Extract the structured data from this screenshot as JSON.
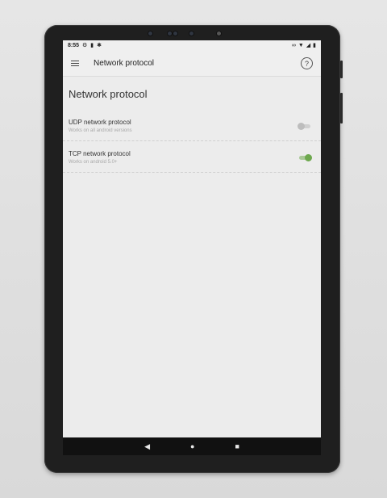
{
  "status_bar": {
    "time": "8:55",
    "left_icons": [
      "gear-icon",
      "sd-card-icon",
      "bug-icon"
    ],
    "right_icons": [
      "link-icon",
      "wifi-icon",
      "signal-icon",
      "battery-icon"
    ]
  },
  "app_bar": {
    "title": "Network protocol",
    "help_glyph": "?"
  },
  "section": {
    "title": "Network protocol"
  },
  "prefs": [
    {
      "title": "UDP network protocol",
      "subtitle": "Works on all android versions",
      "enabled": false
    },
    {
      "title": "TCP network protocol",
      "subtitle": "Works on android 5.0+",
      "enabled": true
    }
  ],
  "nav": {
    "back": "◀",
    "home": "●",
    "recents": "■"
  },
  "colors": {
    "accent_green": "#6da84e",
    "switch_off": "#bdbdbd",
    "bezel": "#1f1f1f"
  }
}
